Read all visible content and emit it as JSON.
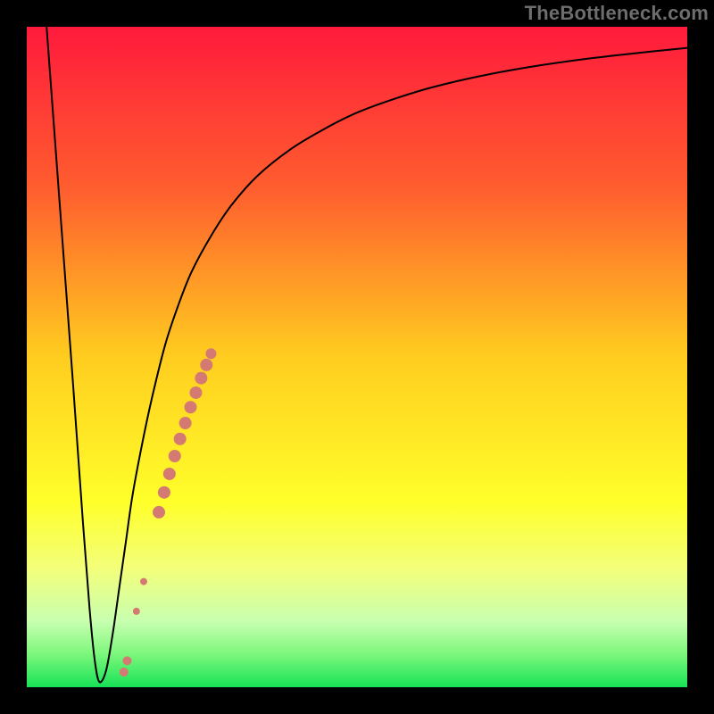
{
  "watermark": "TheBottleneck.com",
  "chart_data": {
    "type": "line",
    "title": "",
    "xlabel": "",
    "ylabel": "",
    "xlim": [
      0,
      100
    ],
    "ylim": [
      0,
      100
    ],
    "background_gradient": {
      "stops": [
        {
          "offset": 0.0,
          "color": "#ff1a3c"
        },
        {
          "offset": 0.25,
          "color": "#ff5f2e"
        },
        {
          "offset": 0.5,
          "color": "#ffcd1f"
        },
        {
          "offset": 0.72,
          "color": "#ffff2a"
        },
        {
          "offset": 0.82,
          "color": "#f3ff7a"
        },
        {
          "offset": 0.9,
          "color": "#c8ffb0"
        },
        {
          "offset": 0.95,
          "color": "#7cf77c"
        },
        {
          "offset": 1.0,
          "color": "#17e257"
        }
      ]
    },
    "series": [
      {
        "name": "bottleneck-curve",
        "color": "#000000",
        "width": 2,
        "x": [
          3,
          5,
          7,
          8.5,
          9.5,
          10.3,
          11,
          12,
          13,
          14,
          15,
          16,
          17.5,
          19,
          21,
          23,
          25,
          28,
          31,
          35,
          40,
          45,
          50,
          56,
          62,
          70,
          78,
          86,
          94,
          100
        ],
        "y": [
          100,
          73,
          46,
          25,
          12,
          4,
          0.8,
          2.5,
          8,
          15,
          22,
          29,
          37,
          44,
          52,
          58,
          63,
          68.5,
          73,
          77.5,
          81.5,
          84.5,
          87,
          89.2,
          91,
          92.8,
          94.2,
          95.3,
          96.2,
          96.8
        ]
      }
    ],
    "scatter": {
      "name": "highlight-points",
      "color": "#d47a72",
      "points": [
        {
          "x": 14.7,
          "y": 2.3,
          "r": 5
        },
        {
          "x": 15.2,
          "y": 4.0,
          "r": 5
        },
        {
          "x": 16.6,
          "y": 11.5,
          "r": 4
        },
        {
          "x": 17.7,
          "y": 16.0,
          "r": 4
        },
        {
          "x": 20.0,
          "y": 26.5,
          "r": 7
        },
        {
          "x": 20.8,
          "y": 29.5,
          "r": 7
        },
        {
          "x": 21.6,
          "y": 32.3,
          "r": 7
        },
        {
          "x": 22.4,
          "y": 35.0,
          "r": 7
        },
        {
          "x": 23.2,
          "y": 37.6,
          "r": 7
        },
        {
          "x": 24.0,
          "y": 40.0,
          "r": 7
        },
        {
          "x": 24.8,
          "y": 42.4,
          "r": 7
        },
        {
          "x": 25.6,
          "y": 44.6,
          "r": 7
        },
        {
          "x": 26.4,
          "y": 46.8,
          "r": 7
        },
        {
          "x": 27.2,
          "y": 48.8,
          "r": 7
        },
        {
          "x": 27.9,
          "y": 50.5,
          "r": 6
        }
      ]
    }
  }
}
